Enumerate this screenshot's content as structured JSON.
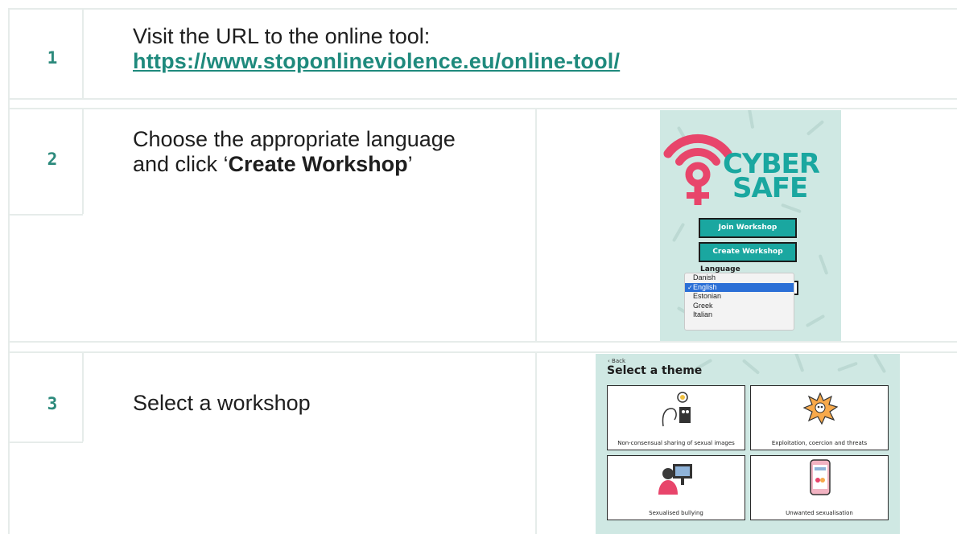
{
  "steps": [
    {
      "number": "1",
      "line1": "Visit the URL to the online tool:",
      "url": "https://www.stoponlineviolence.eu/online-tool/"
    },
    {
      "number": "2",
      "text_before": "Choose the appropriate language and click ‘",
      "bold": "Create Workshop",
      "text_after": "’"
    },
    {
      "number": "3",
      "text": "Select a workshop"
    }
  ],
  "cybersafe": {
    "logo_line1": "CYBER",
    "logo_line2": "SAFE",
    "join_button": "Join Workshop",
    "create_button": "Create Workshop",
    "language_label": "Language",
    "languages": [
      "Danish",
      "English",
      "Estonian",
      "Greek",
      "Italian"
    ],
    "selected_language": "English"
  },
  "themes": {
    "back": "‹ Back",
    "title": "Select a theme",
    "cards": [
      "Non-consensual sharing of sexual images",
      "Exploitation, coercion and threats",
      "Sexualised bullying",
      "Unwanted sexualisation"
    ]
  },
  "colors": {
    "accent": "#2c8a7c",
    "brand_teal": "#1aa7a0",
    "brand_pink": "#e8456b"
  }
}
